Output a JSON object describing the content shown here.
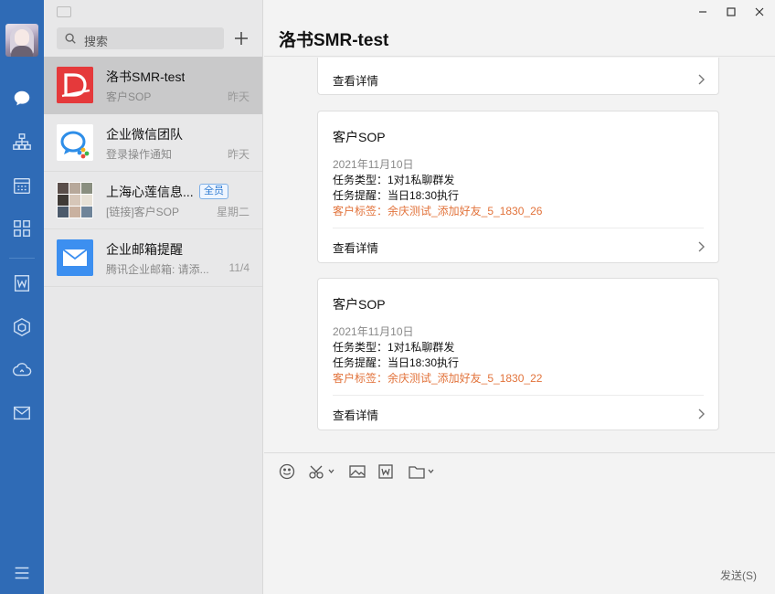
{
  "sidebar": {
    "avatar_label": "",
    "icons": [
      "chat-icon",
      "org-icon",
      "calendar-icon",
      "apps-icon",
      "doc-icon",
      "cube-icon",
      "cloud-icon",
      "mail-icon",
      "menu-icon"
    ],
    "accent": "#2f6bb6"
  },
  "chat_list": {
    "search_placeholder": "搜索",
    "items": [
      {
        "name": "洛书SMR-test",
        "preview": "客户SOP",
        "time": "昨天",
        "active": true
      },
      {
        "name": "企业微信团队",
        "preview": "登录操作通知",
        "time": "昨天",
        "active": false
      },
      {
        "name": "上海心莲信息...",
        "badge": "全员",
        "preview": "[链接]客户SOP",
        "time": "星期二",
        "active": false
      },
      {
        "name": "企业邮箱提醒",
        "preview": "腾讯企业邮箱: 请添...",
        "time": "11/4",
        "active": false
      }
    ]
  },
  "main": {
    "title": "洛书SMR-test",
    "cards": [
      {
        "partial": true,
        "detail": "查看详情"
      },
      {
        "title": "客户SOP",
        "date": "2021年11月10日",
        "task_type": "任务类型：1对1私聊群发",
        "reminder": "任务提醒：当日18:30执行",
        "tag": "客户标签：余庆测试_添加好友_5_1830_26",
        "detail": "查看详情"
      },
      {
        "title": "客户SOP",
        "date": "2021年11月10日",
        "task_type": "任务类型：1对1私聊群发",
        "reminder": "任务提醒：当日18:30执行",
        "tag": "客户标签：余庆测试_添加好友_5_1830_22",
        "detail": "查看详情"
      }
    ],
    "send_label": "发送(S)"
  }
}
